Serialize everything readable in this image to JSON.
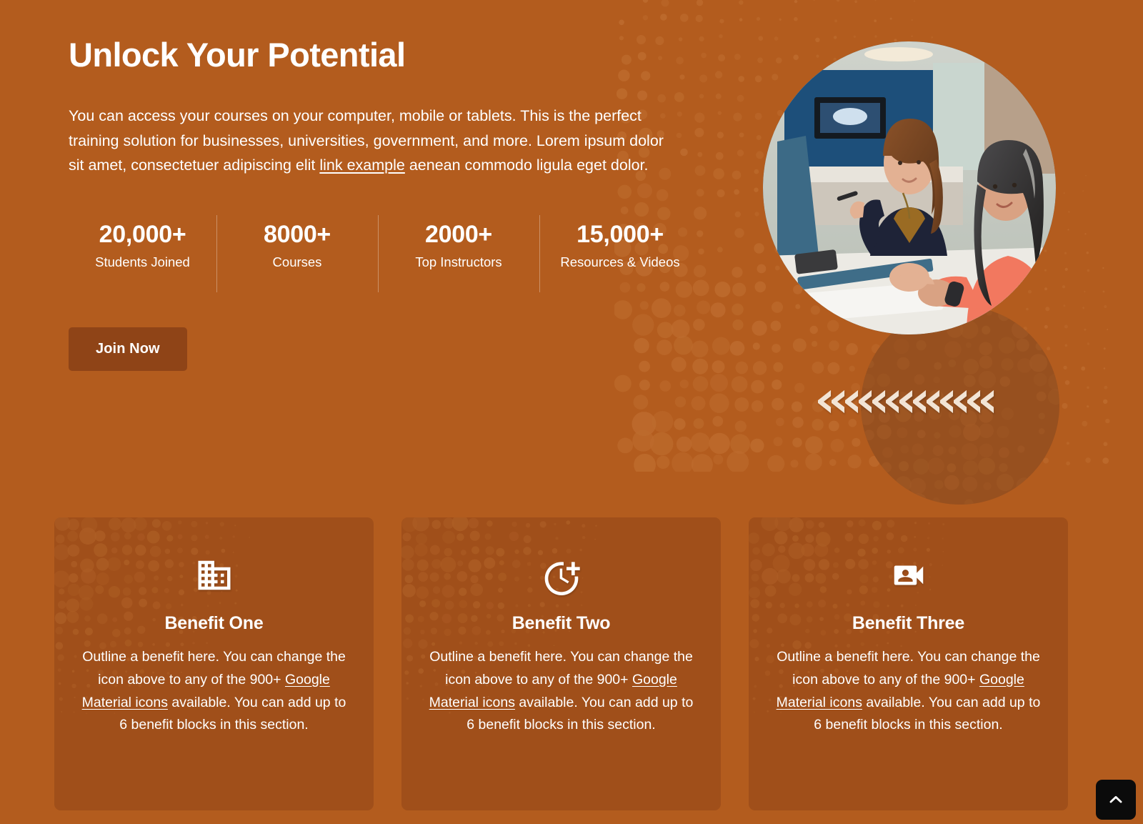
{
  "theme": {
    "background": "#b35c1e",
    "card_background": "#a04f1a",
    "accent_circle": "#97501f",
    "button_background": "#8f4417",
    "text": "#ffffff",
    "chevron": "#f2e4d5",
    "scroll_top_background": "#0b0b0b"
  },
  "hero": {
    "headline": "Unlock Your Potential",
    "intro_part_1": "You can access your courses on your computer, mobile or tablets. This is the perfect training solution for businesses, universities, government, and more. Lorem ipsum dolor sit amet, consectetuer adipiscing elit ",
    "intro_link": "link example",
    "intro_part_2": " aenean commodo ligula eget dolor.",
    "cta_label": "Join Now",
    "photo_alt": "two-women-at-desk-photo",
    "chevron_count": 13
  },
  "stats": [
    {
      "value": "20,000+",
      "label": "Students Joined"
    },
    {
      "value": "8000+",
      "label": "Courses"
    },
    {
      "value": "2000+",
      "label": "Top Instructors"
    },
    {
      "value": "15,000+",
      "label": "Resources & Videos"
    }
  ],
  "benefits": [
    {
      "icon": "domain-building-icon",
      "title": "Benefit One",
      "text_part_1": "Outline a benefit here. You can change the icon above to any of the 900+ ",
      "link": "Google Material icons",
      "text_part_2": " available. You can add up to 6 benefit blocks in this section."
    },
    {
      "icon": "more-time-clock-plus-icon",
      "title": "Benefit Two",
      "text_part_1": "Outline a benefit here. You can change the icon above to any of the 900+ ",
      "link": "Google Material icons",
      "text_part_2": " available. You can add up to 6 benefit blocks in this section."
    },
    {
      "icon": "video-camera-front-icon",
      "title": "Benefit Three",
      "text_part_1": "Outline a benefit here. You can change the icon above to any of the 900+ ",
      "link": "Google Material icons",
      "text_part_2": " available. You can add up to 6 benefit blocks in this section."
    }
  ],
  "scroll_top": {
    "icon": "chevron-up-icon",
    "aria_label": "Scroll to top"
  }
}
